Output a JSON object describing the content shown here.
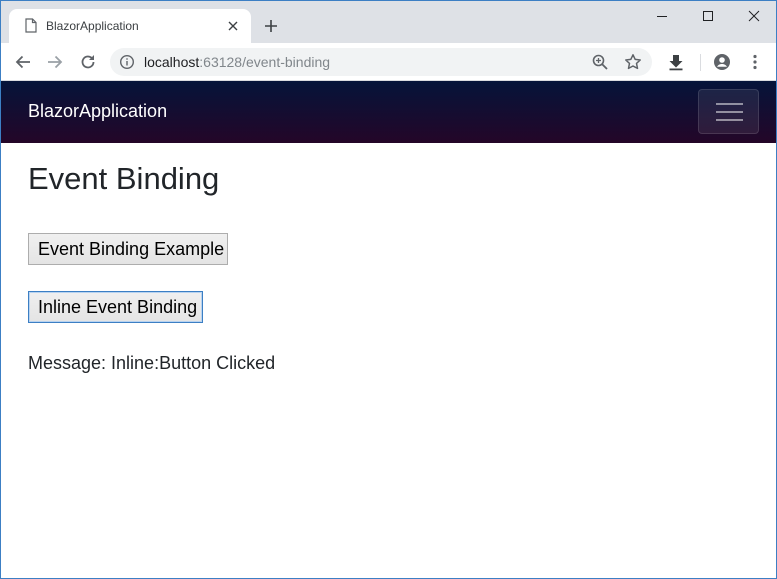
{
  "browser": {
    "tab": {
      "title": "BlazorApplication",
      "icon": "page-icon"
    },
    "address": {
      "host": "localhost",
      "path": ":63128/event-binding"
    }
  },
  "navbar": {
    "brand": "BlazorApplication",
    "toggler_icon": "hamburger-icon"
  },
  "main": {
    "title": "Event Binding",
    "buttons": [
      {
        "label": "Event Binding Example"
      },
      {
        "label": "Inline Event Binding"
      }
    ],
    "message": "Message: Inline:Button Clicked"
  },
  "colors": {
    "navbar_top": "#05143a",
    "navbar_bottom": "#240628",
    "focus_border": "#3c7fc4"
  }
}
